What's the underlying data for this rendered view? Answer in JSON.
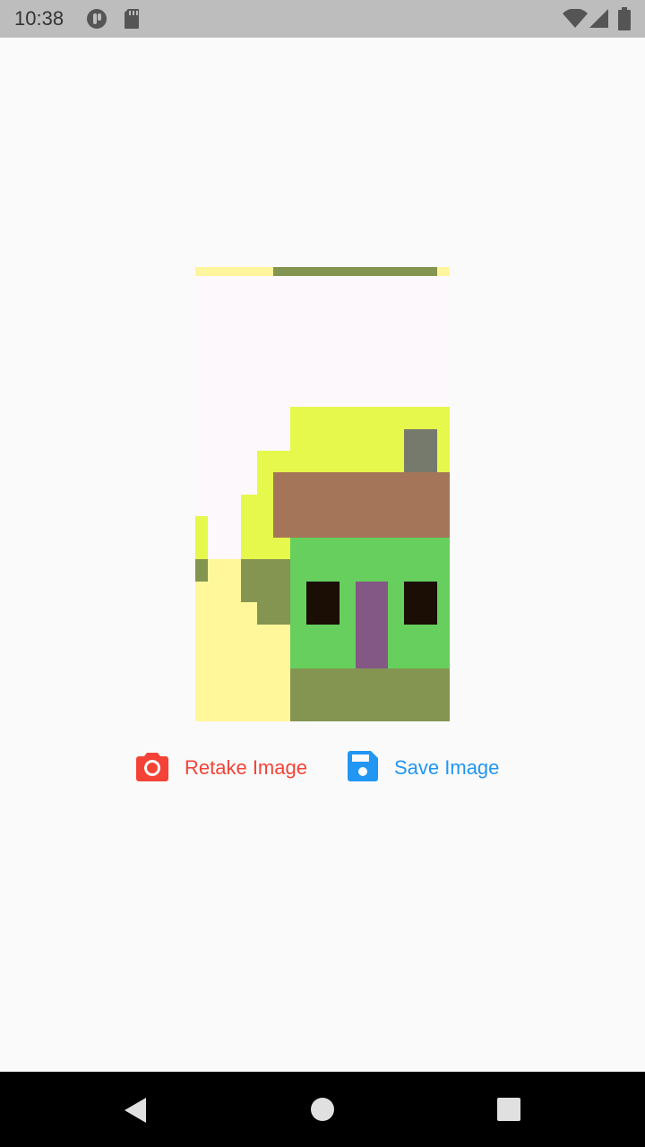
{
  "status_bar": {
    "time": "10:38",
    "icons": [
      "app-notification-icon",
      "sd-card-icon",
      "wifi-icon",
      "signal-icon",
      "battery-icon"
    ]
  },
  "preview": {
    "description_icon": "pixel-art-house-image"
  },
  "actions": {
    "retake_label": "Retake Image",
    "retake_icon": "camera-icon",
    "retake_color": "#f44336",
    "save_label": "Save Image",
    "save_icon": "floppy-disk-icon",
    "save_color": "#2196f3"
  },
  "nav_bar": {
    "buttons": [
      "back-icon",
      "home-icon",
      "recents-icon"
    ]
  }
}
